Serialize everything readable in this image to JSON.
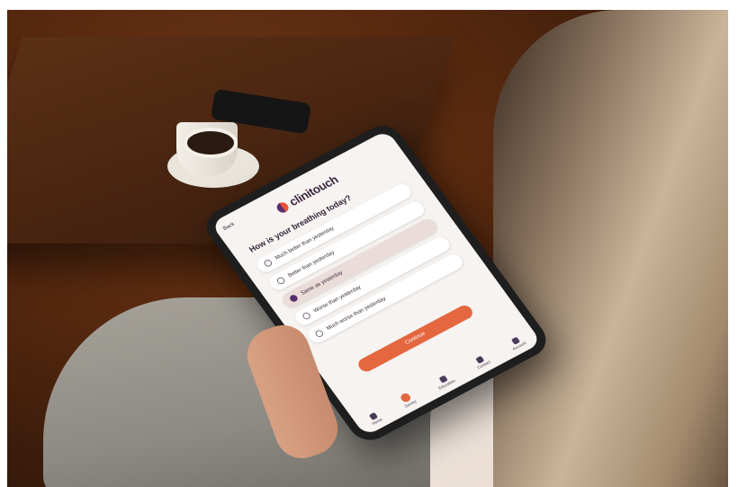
{
  "app": {
    "brand": "clinitouch",
    "back_label": "Back"
  },
  "question": "How is your breathing today?",
  "options": [
    {
      "label": "Much better than yesterday",
      "selected": false
    },
    {
      "label": "Better than yesterday",
      "selected": false
    },
    {
      "label": "Same as yesterday",
      "selected": true
    },
    {
      "label": "Worse than yesterday",
      "selected": false
    },
    {
      "label": "Much worse than yesterday",
      "selected": false
    }
  ],
  "continue_label": "Continue",
  "tabs": [
    {
      "label": "Home",
      "icon": "home-icon",
      "active": false
    },
    {
      "label": "Survey",
      "icon": "survey-icon",
      "active": true
    },
    {
      "label": "Education",
      "icon": "education-icon",
      "active": false
    },
    {
      "label": "Contact",
      "icon": "contact-icon",
      "active": false
    },
    {
      "label": "Account",
      "icon": "account-icon",
      "active": false
    }
  ],
  "colors": {
    "accent": "#e4673f",
    "brand_purple": "#5a2d6e",
    "selected_option_bg": "#e9dcd9"
  }
}
